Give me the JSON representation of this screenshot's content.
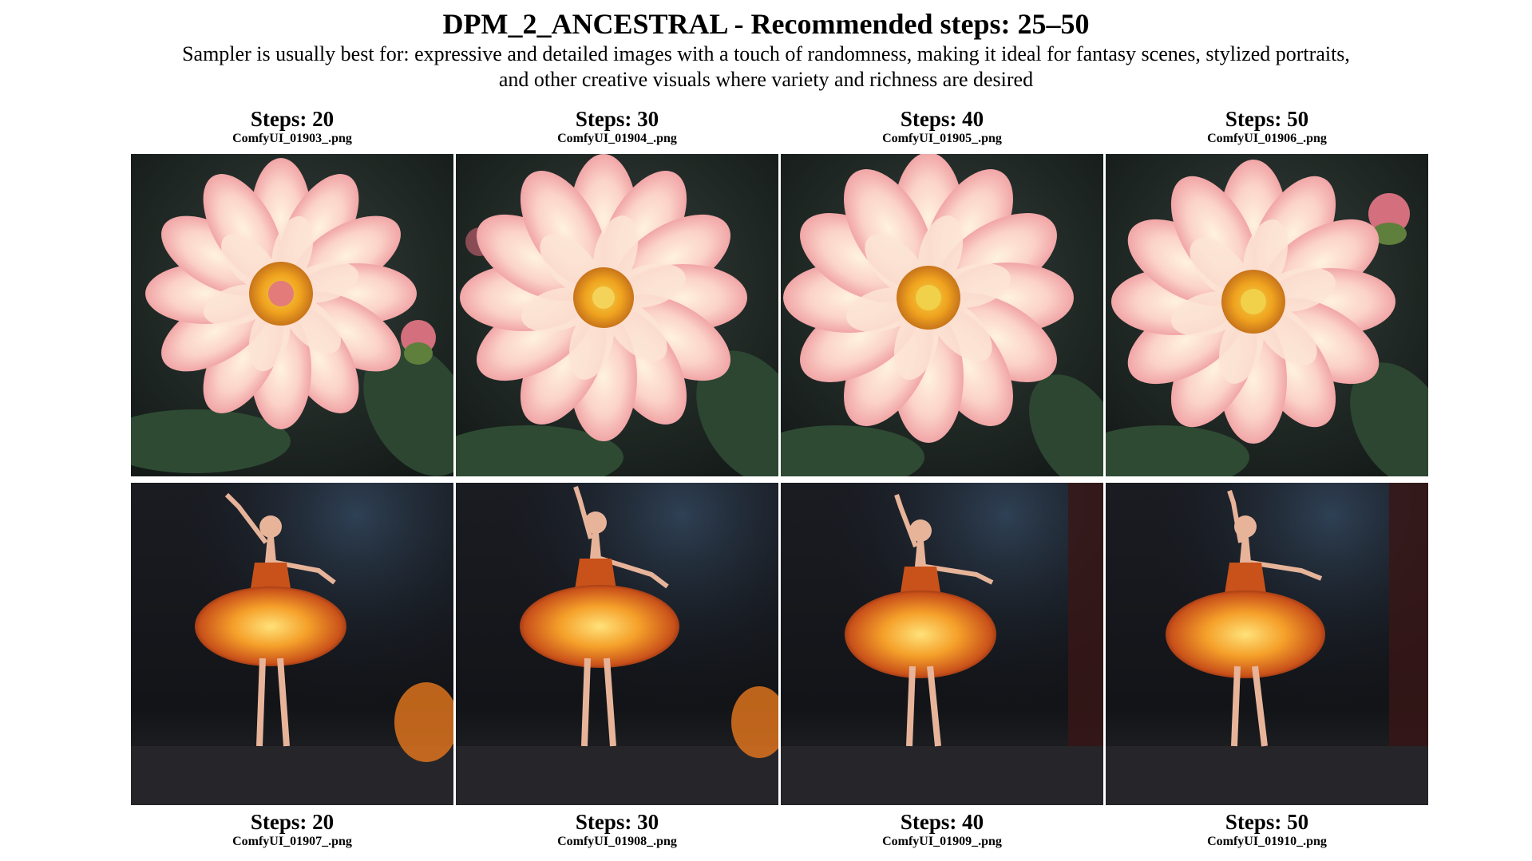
{
  "header": {
    "title": "DPM_2_ANCESTRAL - Recommended steps: 25–50",
    "subtitle_line1": "Sampler is usually best for: expressive and detailed images with a touch of randomness, making it ideal for fantasy scenes, stylized portraits,",
    "subtitle_line2": "and other creative visuals where variety and richness are desired"
  },
  "top_row": [
    {
      "steps": "Steps: 20",
      "file": "ComfyUI_01903_.png"
    },
    {
      "steps": "Steps: 30",
      "file": "ComfyUI_01904_.png"
    },
    {
      "steps": "Steps: 40",
      "file": "ComfyUI_01905_.png"
    },
    {
      "steps": "Steps: 50",
      "file": "ComfyUI_01906_.png"
    }
  ],
  "bottom_row": [
    {
      "steps": "Steps: 20",
      "file": "ComfyUI_01907_.png"
    },
    {
      "steps": "Steps: 30",
      "file": "ComfyUI_01908_.png"
    },
    {
      "steps": "Steps: 40",
      "file": "ComfyUI_01909_.png"
    },
    {
      "steps": "Steps: 50",
      "file": "ComfyUI_01910_.png"
    }
  ],
  "colors": {
    "flower_bg": "#1c2421",
    "petal_pink": "#f6b7b3",
    "petal_light": "#fde3d6",
    "flower_center": "#f0a31f",
    "stage_bg": "#121418",
    "fire_orange": "#f08a1c",
    "fire_yellow": "#ffd45a"
  }
}
